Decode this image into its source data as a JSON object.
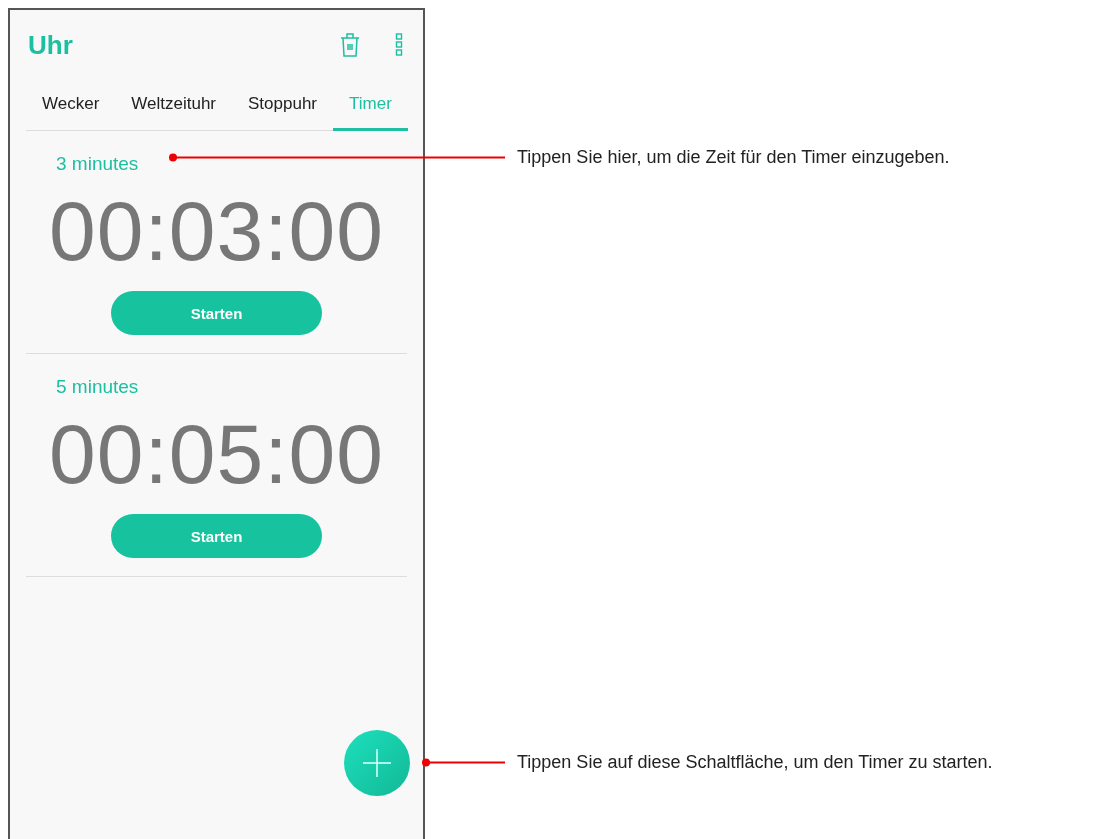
{
  "app_bar": {
    "title": "Uhr"
  },
  "tabs": [
    {
      "label": "Wecker",
      "selected": false
    },
    {
      "label": "Weltzeituhr",
      "selected": false
    },
    {
      "label": "Stoppuhr",
      "selected": false
    },
    {
      "label": "Timer",
      "selected": true
    }
  ],
  "timers": [
    {
      "label": "3 minutes",
      "time": "00:03:00",
      "button": "Starten"
    },
    {
      "label": "5 minutes",
      "time": "00:05:00",
      "button": "Starten"
    }
  ],
  "callouts": [
    {
      "text": "Tippen Sie hier, um die Zeit für den Timer einzugeben."
    },
    {
      "text": "Tippen Sie auf diese Schaltfläche, um den Timer zu starten."
    }
  ]
}
